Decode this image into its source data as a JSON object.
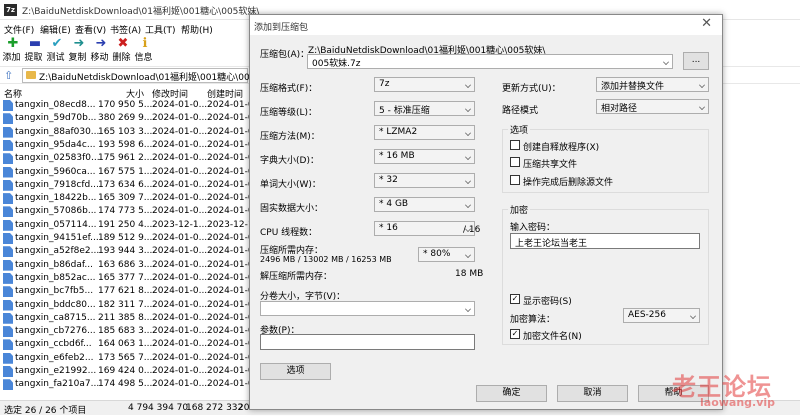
{
  "window": {
    "title": "Z:\\BaiduNetdiskDownload\\01福利姬\\001糖心\\005软妹\\"
  },
  "menu": [
    "文件(F)",
    "编辑(E)",
    "查看(V)",
    "书签(A)",
    "工具(T)",
    "帮助(H)"
  ],
  "toolbar": [
    {
      "label": "添加",
      "icon": "plus-icon",
      "color": "#1a9e2a",
      "glyph": "✚"
    },
    {
      "label": "提取",
      "icon": "minus-icon",
      "color": "#2b3fb0",
      "glyph": "▬"
    },
    {
      "label": "测试",
      "icon": "check-icon",
      "color": "#2a9fbf",
      "glyph": "✔"
    },
    {
      "label": "复制",
      "icon": "copy-arrow-icon",
      "color": "#1f8f8f",
      "glyph": "➜"
    },
    {
      "label": "移动",
      "icon": "move-arrow-icon",
      "color": "#2b3fb0",
      "glyph": "➜"
    },
    {
      "label": "删除",
      "icon": "delete-x-icon",
      "color": "#cc1f1f",
      "glyph": "✖"
    },
    {
      "label": "信息",
      "icon": "info-icon",
      "color": "#d8a11a",
      "glyph": "ℹ"
    }
  ],
  "address": {
    "path": "Z:\\BaiduNetdiskDownload\\01福利姬\\001糖心\\005软妹\\"
  },
  "columns": {
    "name": "名称",
    "size": "大小",
    "modified": "修改时间",
    "created": "创建时间"
  },
  "files": [
    {
      "name": "tangxin_08ecd8...",
      "size": "170 950 5...",
      "modified": "2024-01-0...",
      "created": "2024-01-0..."
    },
    {
      "name": "tangxin_59d70b...",
      "size": "380 269 9...",
      "modified": "2024-01-0...",
      "created": "2024-01-0..."
    },
    {
      "name": "tangxin_88af030...",
      "size": "165 103 3...",
      "modified": "2024-01-0...",
      "created": "2024-01-0..."
    },
    {
      "name": "tangxin_95da4c...",
      "size": "193 598 6...",
      "modified": "2024-01-0...",
      "created": "2024-01-0..."
    },
    {
      "name": "tangxin_02583f0...",
      "size": "175 961 2...",
      "modified": "2024-01-0...",
      "created": "2024-01-0..."
    },
    {
      "name": "tangxin_5960ca...",
      "size": "167 575 1...",
      "modified": "2024-01-0...",
      "created": "2024-01-0..."
    },
    {
      "name": "tangxin_7918cfd...",
      "size": "173 634 6...",
      "modified": "2024-01-0...",
      "created": "2024-01-0..."
    },
    {
      "name": "tangxin_18422b...",
      "size": "165 309 7...",
      "modified": "2024-01-0...",
      "created": "2024-01-0..."
    },
    {
      "name": "tangxin_57086b...",
      "size": "174 773 5...",
      "modified": "2024-01-0...",
      "created": "2024-01-0..."
    },
    {
      "name": "tangxin_057114...",
      "size": "191 250 4...",
      "modified": "2023-12-1...",
      "created": "2023-12-1..."
    },
    {
      "name": "tangxin_94151ef...",
      "size": "189 512 9...",
      "modified": "2024-01-0...",
      "created": "2024-01-0..."
    },
    {
      "name": "tangxin_a52f8e2...",
      "size": "193 944 3...",
      "modified": "2024-01-0...",
      "created": "2024-01-0..."
    },
    {
      "name": "tangxin_b86daf...",
      "size": "163 686 3...",
      "modified": "2024-01-0...",
      "created": "2024-01-0..."
    },
    {
      "name": "tangxin_b852ac...",
      "size": "165 377 7...",
      "modified": "2024-01-0...",
      "created": "2024-01-0..."
    },
    {
      "name": "tangxin_bc7fb5...",
      "size": "177 621 8...",
      "modified": "2024-01-0...",
      "created": "2024-01-0..."
    },
    {
      "name": "tangxin_bddc80...",
      "size": "182 311 7...",
      "modified": "2024-01-0...",
      "created": "2024-01-0..."
    },
    {
      "name": "tangxin_ca8715...",
      "size": "211 385 8...",
      "modified": "2024-01-0...",
      "created": "2024-01-0..."
    },
    {
      "name": "tangxin_cb7276...",
      "size": "185 683 3...",
      "modified": "2024-01-0...",
      "created": "2024-01-0..."
    },
    {
      "name": "tangxin_ccbd6f...",
      "size": "164 063 1...",
      "modified": "2024-01-0...",
      "created": "2024-01-0..."
    },
    {
      "name": "tangxin_e6feb2...",
      "size": "173 565 7...",
      "modified": "2024-01-0...",
      "created": "2024-01-0..."
    },
    {
      "name": "tangxin_e21992...",
      "size": "169 424 0...",
      "modified": "2024-01-0...",
      "created": "2024-01-0..."
    },
    {
      "name": "tangxin_fa210a7...",
      "size": "174 498 5...",
      "modified": "2024-01-0...",
      "created": "2024-01-0..."
    }
  ],
  "status": {
    "selected": "选定 26 / 26 个项目",
    "total_size": "4 794 394 70",
    "packed_size": "168 272 332",
    "extra": "20"
  },
  "dialog": {
    "title": "添加到压缩包",
    "archive_label": "压缩包(A)：",
    "archive_dir": "Z:\\BaiduNetdiskDownload\\01福利姬\\001糖心\\005软妹\\",
    "archive_name": "005软妹.7z",
    "browse_label": "...",
    "format_label": "压缩格式(F)：",
    "format_value": "7z",
    "level_label": "压缩等级(L)：",
    "level_value": "5 - 标准压缩",
    "method_label": "压缩方法(M)：",
    "method_value": "* LZMA2",
    "dict_label": "字典大小(D)：",
    "dict_value": "* 16 MB",
    "word_label": "单词大小(W)：",
    "word_value": "* 32",
    "solid_label": "固实数据大小：",
    "solid_value": "* 4 GB",
    "threads_label": "CPU 线程数：",
    "threads_value": "* 16",
    "threads_total": "/ 16",
    "memc_label": "压缩所需内存：",
    "memc_value": "2496 MB / 13002 MB / 16253 MB",
    "memc_pct": "* 80%",
    "memd_label": "解压缩所需内存：",
    "memd_value": "18 MB",
    "split_label": "分卷大小，字节(V)：",
    "split_value": "",
    "params_label": "参数(P)：",
    "params_value": "",
    "options_btn": "选项",
    "update_label": "更新方式(U)：",
    "update_value": "添加并替换文件",
    "pathmode_label": "路径模式",
    "pathmode_value": "相对路径",
    "options_group": "选项",
    "sfx_label": "创建自释放程序(X)",
    "shared_label": "压缩共享文件",
    "delete_label": "操作完成后删除源文件",
    "enc_group": "加密",
    "pwd_label": "输入密码：",
    "pwd_value": "上老王论坛当老王",
    "showpwd_label": "显示密码(S)",
    "encmethod_label": "加密算法：",
    "encmethod_value": "AES-256",
    "encnames_label": "加密文件名(N)",
    "ok": "确定",
    "cancel": "取消",
    "help": "帮助"
  },
  "watermark": {
    "text": "老王论坛",
    "url": "laowang.vip"
  }
}
